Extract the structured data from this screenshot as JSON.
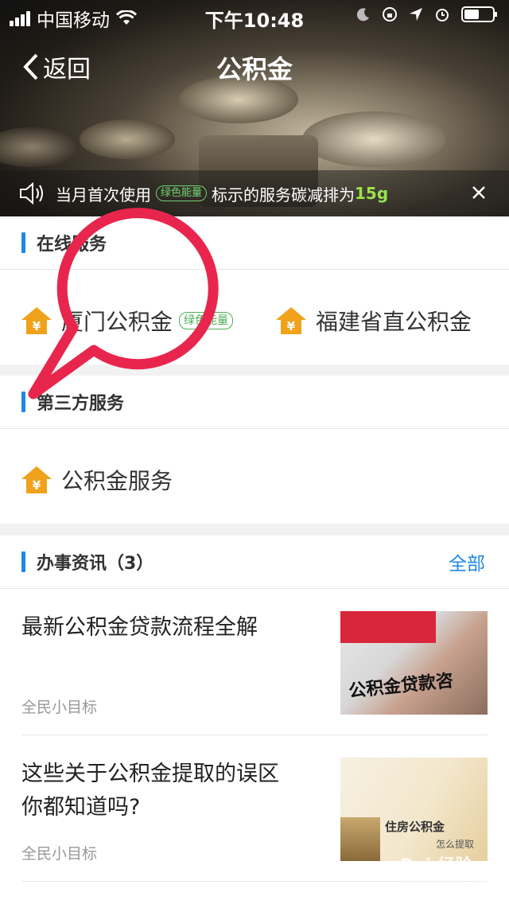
{
  "status_bar": {
    "carrier": "中国移动",
    "time": "下午10:48"
  },
  "nav": {
    "back_label": "返回",
    "title": "公积金"
  },
  "notice": {
    "text_before": "当月首次使用",
    "badge": "绿色能量",
    "text_after": "标示的服务碳减排为",
    "weight": "15g"
  },
  "online_services": {
    "title": "在线服务",
    "items": [
      {
        "label": "厦门公积金",
        "badge": "绿色能量"
      },
      {
        "label": "福建省直公积金"
      }
    ]
  },
  "third_party": {
    "title": "第三方服务",
    "items": [
      {
        "label": "公积金服务"
      }
    ]
  },
  "news": {
    "title": "办事资讯（3）",
    "more_label": "全部",
    "items": [
      {
        "headline": "最新公积金贷款流程全解",
        "source": "全民小目标",
        "thumb_text": "公积金贷款咨"
      },
      {
        "headline": "这些关于公积金提取的误区 你都知道吗?",
        "source": "全民小目标",
        "thumb_text": "住房公积金",
        "thumb_sub": "怎么提取"
      }
    ]
  },
  "watermark": "Bai 经验",
  "watermark_sub": "jingyan.baidu.com",
  "colors": {
    "accent": "#1e88e5",
    "green": "#4caf50",
    "icon_gold": "#f0a21c",
    "annotation": "#e8264d"
  }
}
